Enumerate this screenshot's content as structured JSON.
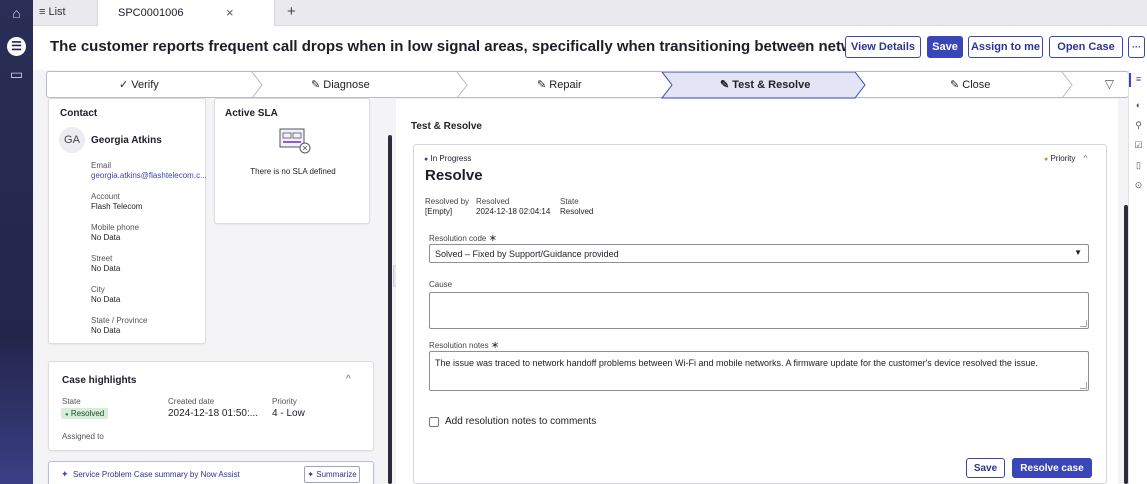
{
  "rail": {
    "home_icon": "⌂",
    "menu_icon": "☰",
    "inbox_icon": "▭"
  },
  "tabs": {
    "list_label": "≡ List",
    "case_label": "SPC0001006",
    "close_glyph": "×",
    "add_glyph": "+"
  },
  "header": {
    "title": "The customer reports frequent call drops when in low signal areas, specifically when transitioning between networks.",
    "tag_icon": "⊘",
    "view_details": "View Details",
    "save": "Save",
    "assign_to_me": "Assign to me",
    "open_case": "Open Case",
    "more": "···"
  },
  "stepper": {
    "steps": [
      {
        "label": "✓ Verify",
        "state": "done"
      },
      {
        "label": "✎ Diagnose",
        "state": "todo"
      },
      {
        "label": "✎ Repair",
        "state": "todo"
      },
      {
        "label": "✎ Test & Resolve",
        "state": "active"
      },
      {
        "label": "✎ Close",
        "state": "todo"
      }
    ],
    "filter_icon": "▽"
  },
  "contact": {
    "heading": "Contact",
    "initials": "GA",
    "name": "Georgia Atkins",
    "fields": [
      {
        "label": "Email",
        "value": "georgia.atkins@flashtelecom.c...",
        "link": true
      },
      {
        "label": "Account",
        "value": "Flash Telecom"
      },
      {
        "label": "Mobile phone",
        "value": "No Data"
      },
      {
        "label": "Street",
        "value": "No Data"
      },
      {
        "label": "City",
        "value": "No Data"
      },
      {
        "label": "State / Province",
        "value": "No Data"
      }
    ]
  },
  "sla": {
    "heading": "Active SLA",
    "empty_text": "There is no SLA defined"
  },
  "highlights": {
    "heading": "Case highlights",
    "chevron": "^",
    "state_label": "State",
    "state_value": "Resolved",
    "created_label": "Created date",
    "created_value": "2024-12-18 01:50:...",
    "priority_label": "Priority",
    "priority_value": "4 - Low",
    "assigned_label": "Assigned to"
  },
  "summary": {
    "text": "Service Problem Case summary by Now Assist",
    "button": "Summarize"
  },
  "panel": {
    "title": "Test & Resolve",
    "status": "In Progress",
    "priority": "Priority",
    "chevron": "^",
    "heading": "Resolve",
    "resolved_by_label": "Resolved by",
    "resolved_by_value": "[Empty]",
    "resolved_label": "Resolved",
    "resolved_value": "2024-12-18 02:04:14",
    "state_label": "State",
    "state_value": "Resolved",
    "resolution_code_label": "Resolution code",
    "resolution_code_value": "Solved – Fixed by Support/Guidance provided",
    "cause_label": "Cause",
    "cause_value": "",
    "resolution_notes_label": "Resolution notes",
    "resolution_notes_value": "The issue was traced to network handoff problems between Wi-Fi and mobile networks. A firmware update for the customer's device resolved the issue.",
    "add_notes_label": "Add resolution notes to comments",
    "save": "Save",
    "resolve_case": "Resolve case"
  },
  "colors": {
    "accent": "#3a46b8",
    "rail": "#23264b",
    "status_green": "#2e8540",
    "priority_orange": "#e08a1e",
    "resolved_badge_bg": "#d7ecd9"
  }
}
